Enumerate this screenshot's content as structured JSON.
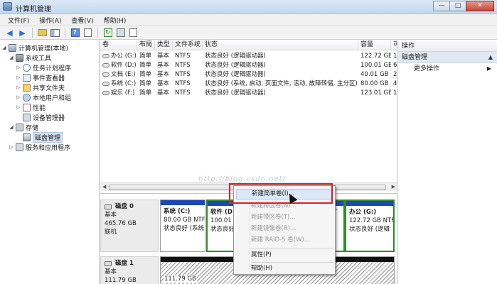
{
  "window": {
    "title": "计算机管理",
    "buttons": [
      "—",
      "□",
      "✕"
    ]
  },
  "menu": [
    "文件(F)",
    "操作(A)",
    "查看(V)",
    "帮助(H)"
  ],
  "tree": {
    "root": "计算机管理(本地)",
    "system_tools": "系统工具",
    "task_scheduler": "任务计划程序",
    "event_viewer": "事件查看器",
    "shared_folders": "共享文件夹",
    "local_users": "本地用户和组",
    "performance": "性能",
    "device_manager": "设备管理器",
    "storage": "存储",
    "disk_management": "磁盘管理",
    "services_apps": "服务和应用程序"
  },
  "columns": [
    "卷",
    "布局",
    "类型",
    "文件系统",
    "状态",
    "容量",
    "可"
  ],
  "volumes": [
    {
      "name": "办公 (G:)",
      "layout": "简单",
      "type": "基本",
      "fs": "NTFS",
      "status": "状态良好 (逻辑驱动器)",
      "capacity": "122.72 GB",
      "free": "1"
    },
    {
      "name": "软件 (D:)",
      "layout": "简单",
      "type": "基本",
      "fs": "NTFS",
      "status": "状态良好 (逻辑驱动器)",
      "capacity": "100.01 GB",
      "free": "6"
    },
    {
      "name": "文档 (E:)",
      "layout": "简单",
      "type": "基本",
      "fs": "NTFS",
      "status": "状态良好 (逻辑驱动器)",
      "capacity": "40.01 GB",
      "free": "2"
    },
    {
      "name": "系统 (C:)",
      "layout": "简单",
      "type": "基本",
      "fs": "NTFS",
      "status": "状态良好 (系统, 启动, 页面文件, 活动, 故障转储, 主分区)",
      "capacity": "80.00 GB",
      "free": "4"
    },
    {
      "name": "娱乐 (F:)",
      "layout": "简单",
      "type": "基本",
      "fs": "NTFS",
      "status": "状态良好 (逻辑驱动器)",
      "capacity": "123.01 GB",
      "free": "1"
    }
  ],
  "watermark": "http://blog.csdn.net/",
  "disk0": {
    "name": "磁盘 0",
    "kind": "基本",
    "size": "465.76 GB",
    "state": "联机",
    "partitions": [
      {
        "name": "系统 (C:)",
        "size": "80.00 GB NTF",
        "status": "状态良好 (系统"
      },
      {
        "name": "软件 (D",
        "size": "100.01",
        "status": "状态良好"
      },
      {
        "name": "",
        "size": "T",
        "status": ""
      },
      {
        "name": "办公 (G:)",
        "size": "122.72 GB NTF",
        "status": "状态良好 (逻辑"
      }
    ]
  },
  "disk1": {
    "name": "磁盘 1",
    "kind": "基本",
    "size": "111.79 GB",
    "partition_size": "111.79 GB"
  },
  "actions": {
    "header": "操作",
    "section": "磁盘管理",
    "more": "更多操作"
  },
  "context_menu": {
    "new_simple": "新建简单卷(I)...",
    "new_spanned": "新建跨区卷(N)...",
    "new_striped": "新建带区卷(T)...",
    "new_mirrored": "新建镜像卷(R)...",
    "new_raid5": "新建 RAID-5 卷(W)...",
    "properties": "属性(P)",
    "help": "帮助(H)"
  }
}
